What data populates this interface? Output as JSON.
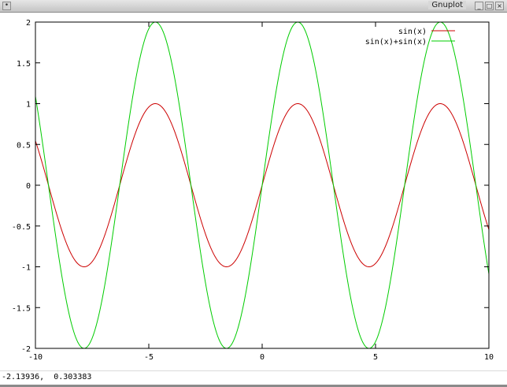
{
  "window": {
    "title": "Gnuplot",
    "menu_icon": "window-menu-icon",
    "min_icon": "minimize-icon",
    "max_icon": "maximize-icon",
    "close_icon": "close-icon",
    "menu_glyph": "•",
    "min_glyph": "_",
    "max_glyph": "□",
    "close_glyph": "×"
  },
  "status": {
    "coordinates": "-2.13936,  0.303383"
  },
  "chart_data": {
    "type": "line",
    "title": "",
    "xlabel": "",
    "ylabel": "",
    "xlim": [
      -10,
      10
    ],
    "ylim": [
      -2,
      2
    ],
    "xticks": [
      -10,
      -5,
      0,
      5,
      10
    ],
    "yticks": [
      -2,
      -1.5,
      -1,
      -0.5,
      0,
      0.5,
      1,
      1.5,
      2
    ],
    "xtick_labels": [
      "-10",
      "-5",
      "0",
      "5",
      "10"
    ],
    "ytick_labels": [
      "-2",
      "-1.5",
      "-1",
      "-0.5",
      "0",
      "0.5",
      "1",
      "1.5",
      "2"
    ],
    "grid": false,
    "legend_position": "top-right",
    "series": [
      {
        "name": "sin(x)",
        "expression": "sin(x)",
        "color": "#cc0000"
      },
      {
        "name": "sin(x)+sin(x)",
        "expression": "sin(x)+sin(x)",
        "color": "#00cc00"
      }
    ]
  }
}
